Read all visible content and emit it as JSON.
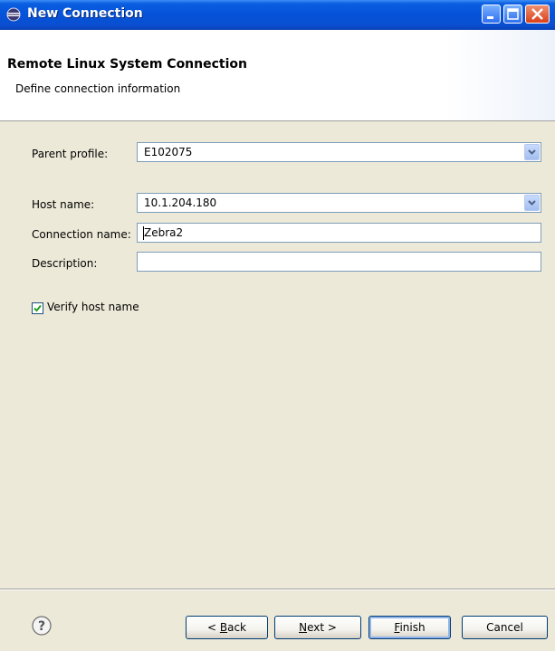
{
  "window": {
    "title": "New Connection"
  },
  "banner": {
    "title": "Remote Linux System Connection",
    "description": "Define connection information"
  },
  "form": {
    "parent_profile_label": "Parent profile:",
    "parent_profile_value": "E102075",
    "host_name_label": "Host name:",
    "host_name_value": "10.1.204.180",
    "connection_name_label": "Connection name:",
    "connection_name_value": "Zebra2",
    "description_label": "Description:",
    "description_value": "",
    "verify_host_label": "Verify host name",
    "verify_host_checked": true
  },
  "buttons": {
    "back_prefix": "< ",
    "back_mnemonic": "B",
    "back_rest": "ack",
    "next_mnemonic": "N",
    "next_rest": "ext >",
    "finish_mnemonic": "F",
    "finish_rest": "inish",
    "cancel": "Cancel"
  },
  "icons": {
    "app": "eclipse-icon",
    "help": "help-icon",
    "minimize": "minimize-icon",
    "maximize": "maximize-icon",
    "close": "close-icon",
    "dropdown": "chevron-down-icon",
    "check": "checkmark-icon"
  },
  "colors": {
    "titlebar": "#0552d9",
    "dialog_bg": "#ece9d8",
    "field_border": "#7f9db9"
  }
}
